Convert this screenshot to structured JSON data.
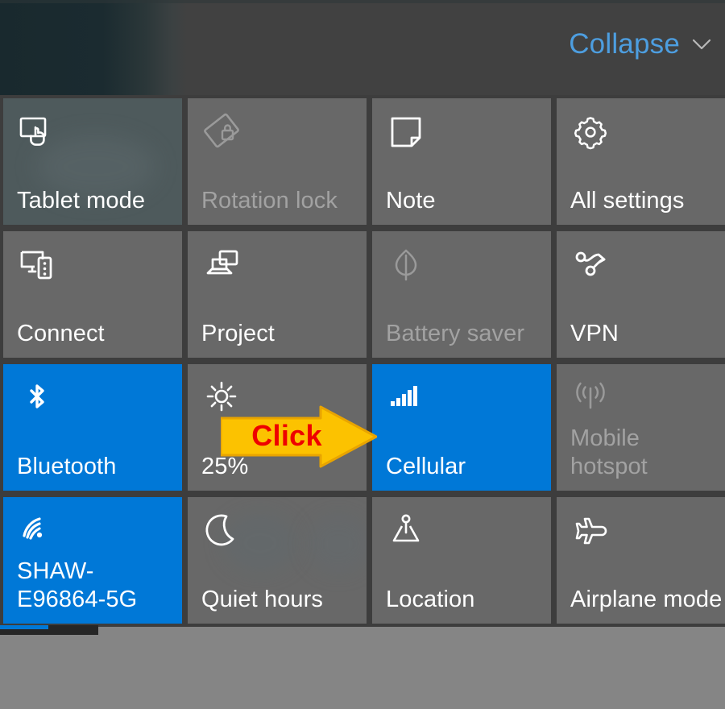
{
  "window": {
    "name": "Windows 10 Action Center quick actions",
    "background_color": "#858585",
    "panel_color": "#3d3d3d"
  },
  "header": {
    "collapse_label": "Collapse",
    "collapse_icon": "chevron-down-icon",
    "link_color": "#4d9ee0"
  },
  "colors": {
    "accent": "#0078d7",
    "tile": "#686868",
    "tile_tinted": "#4e5a5c",
    "disabled_text": "#a2a2a2",
    "callout_fill": "#fcc200",
    "callout_stroke": "#e8a400",
    "callout_text": "#ee0000"
  },
  "callout": {
    "label": "Click",
    "shape": "right-arrow",
    "points_to": "Cellular"
  },
  "tiles": [
    {
      "id": "tablet-mode",
      "label": "Tablet mode",
      "icon": "tablet-mode-icon",
      "state": "tinted",
      "enabled": true
    },
    {
      "id": "rotation-lock",
      "label": "Rotation lock",
      "icon": "rotation-lock-icon",
      "state": "off",
      "enabled": false
    },
    {
      "id": "note",
      "label": "Note",
      "icon": "note-icon",
      "state": "off",
      "enabled": true
    },
    {
      "id": "all-settings",
      "label": "All settings",
      "icon": "gear-icon",
      "state": "off",
      "enabled": true
    },
    {
      "id": "connect",
      "label": "Connect",
      "icon": "connect-icon",
      "state": "off",
      "enabled": true
    },
    {
      "id": "project",
      "label": "Project",
      "icon": "project-icon",
      "state": "off",
      "enabled": true
    },
    {
      "id": "battery-saver",
      "label": "Battery saver",
      "icon": "leaf-icon",
      "state": "off",
      "enabled": false
    },
    {
      "id": "vpn",
      "label": "VPN",
      "icon": "vpn-icon",
      "state": "off",
      "enabled": true
    },
    {
      "id": "bluetooth",
      "label": "Bluetooth",
      "icon": "bluetooth-icon",
      "state": "on",
      "enabled": true
    },
    {
      "id": "brightness",
      "label": "25%",
      "icon": "brightness-icon",
      "state": "off",
      "enabled": true
    },
    {
      "id": "cellular",
      "label": "Cellular",
      "icon": "signal-bars-icon",
      "state": "on",
      "enabled": true
    },
    {
      "id": "mobile-hotspot",
      "label": "Mobile\nhotspot",
      "icon": "hotspot-icon",
      "state": "off",
      "enabled": false
    },
    {
      "id": "wifi",
      "label": "SHAW-\nE96864-5G",
      "icon": "wifi-icon",
      "state": "on",
      "enabled": true
    },
    {
      "id": "quiet-hours",
      "label": "Quiet hours",
      "icon": "moon-icon",
      "state": "off",
      "enabled": true
    },
    {
      "id": "location",
      "label": "Location",
      "icon": "location-icon",
      "state": "off",
      "enabled": true
    },
    {
      "id": "airplane-mode",
      "label": "Airplane mode",
      "icon": "airplane-icon",
      "state": "off",
      "enabled": true
    }
  ]
}
